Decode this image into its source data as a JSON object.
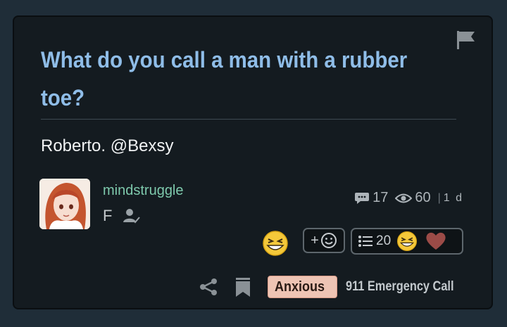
{
  "post": {
    "title": "What do you call a man with a rubber toe?",
    "body": "Roberto. @Bexsy"
  },
  "author": {
    "username": "mindstruggle",
    "gender": "F"
  },
  "stats": {
    "comments": "17",
    "views": "60",
    "age": "1 d"
  },
  "reactions": {
    "add_label": "+",
    "count": "20"
  },
  "footer": {
    "tag": "Anxious",
    "category": "911 Emergency Call"
  },
  "colors": {
    "background": "#1f2d38",
    "card": "#141b20",
    "title": "#8fbde8",
    "username": "#7ec9ac",
    "tag_bg": "#eec4b4"
  }
}
